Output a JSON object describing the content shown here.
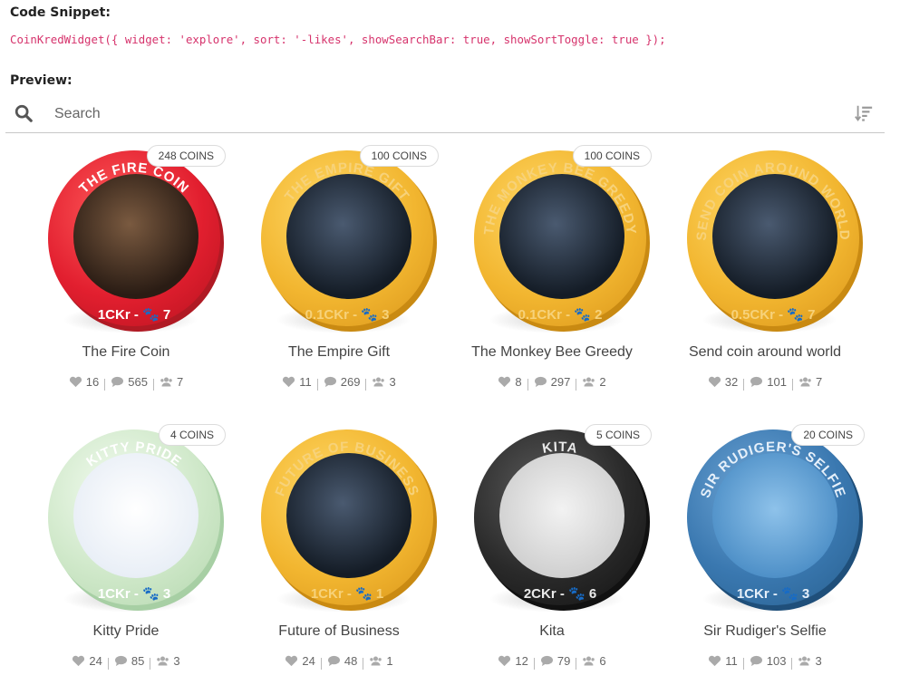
{
  "labels": {
    "snippet": "Code Snippet:",
    "preview": "Preview:"
  },
  "code": "CoinKredWidget({ widget: 'explore', sort: '-likes', showSearchBar: true, showSortToggle: true });",
  "search": {
    "placeholder": "Search"
  },
  "colors": {
    "code": "#d6336c",
    "gold": "#f2b630",
    "red": "#e21f2f"
  },
  "coins": [
    {
      "title": "The Fire Coin",
      "badge": "248 COINS",
      "ring": "THE FIRE COIN",
      "denom": "1CKr - 🐾 7",
      "likes": "16",
      "comments": "565",
      "owners": "7",
      "rim": "red"
    },
    {
      "title": "The Empire Gift",
      "badge": "100 COINS",
      "ring": "THE EMPIRE GIFT",
      "denom": "0.1CKr - 🐾 3",
      "likes": "11",
      "comments": "269",
      "owners": "3",
      "rim": "gold"
    },
    {
      "title": "The Monkey Bee Greedy",
      "badge": "100 COINS",
      "ring": "THE MONKEY BEE GREEDY",
      "denom": "0.1CKr - 🐾 2",
      "likes": "8",
      "comments": "297",
      "owners": "2",
      "rim": "gold"
    },
    {
      "title": "Send coin around world",
      "badge": "",
      "ring": "SEND COIN AROUND WORLD",
      "denom": "0.5CKr - 🐾 7",
      "likes": "32",
      "comments": "101",
      "owners": "7",
      "rim": "gold"
    },
    {
      "title": "Kitty Pride",
      "badge": "4 COINS",
      "ring": "KITTY PRIDE",
      "denom": "1CKr - 🐾 3",
      "likes": "24",
      "comments": "85",
      "owners": "3",
      "rim": "mint"
    },
    {
      "title": "Future of Business",
      "badge": "",
      "ring": "FUTURE OF BUSINESS",
      "denom": "1CKr - 🐾 1",
      "likes": "24",
      "comments": "48",
      "owners": "1",
      "rim": "gold"
    },
    {
      "title": "Kita",
      "badge": "5 COINS",
      "ring": "KITA",
      "denom": "2CKr - 🐾 6",
      "likes": "12",
      "comments": "79",
      "owners": "6",
      "rim": "black"
    },
    {
      "title": "Sir Rudiger's Selfie",
      "badge": "20 COINS",
      "ring": "SIR RUDIGER'S SELFIE",
      "denom": "1CKr - 🐾 3",
      "likes": "11",
      "comments": "103",
      "owners": "3",
      "rim": "blue"
    }
  ],
  "icons": {
    "search": "search-icon",
    "sort": "sort-descending-icon",
    "like": "heart-icon",
    "comment": "comment-icon",
    "owners": "users-icon"
  }
}
